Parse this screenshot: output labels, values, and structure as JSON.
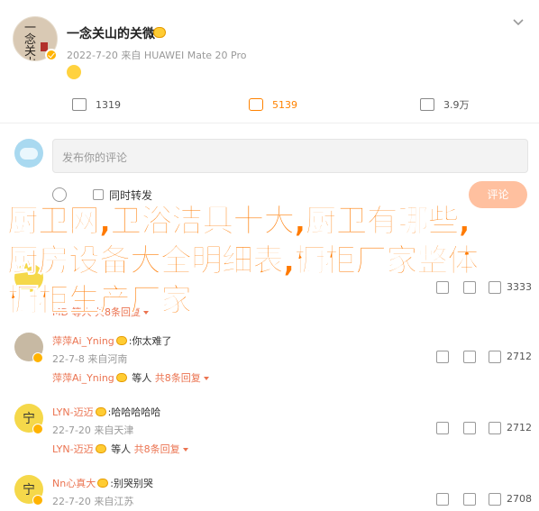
{
  "post": {
    "author": "一念关山的关微",
    "meta": "2022-7-20  来自 HUAWEI Mate 20 Pro",
    "author_avatar_text": "一念关山",
    "avatar_icon": "calligraphy-avatar",
    "verified_icon": "verified-badge-icon",
    "more_icon": "chevron-down-icon"
  },
  "stats": {
    "repost": "1319",
    "comment": "5139",
    "like": "3.9万",
    "colors": {
      "comment_accent": "#ff8200"
    }
  },
  "composer": {
    "placeholder": "发布你的评论",
    "forward_label": "同时转发",
    "reply_button": "评论",
    "reply_button_color": "#ffc09f"
  },
  "comments": [
    {
      "user": "",
      "text": "",
      "avatar_glyph": "",
      "time": "",
      "reply_user": "",
      "reply_text": "",
      "reply_count": "",
      "likes": "3333"
    },
    {
      "user": "萍萍Ai_Yning",
      "text": ":你太难了",
      "avatar_glyph": "",
      "time": "22-7-8 来自河南",
      "reply_user": "萍萍Ai_Yning",
      "reply_text": "等人",
      "reply_count": "共8条回复",
      "likes": "2712"
    },
    {
      "user": "LYN-迈迈",
      "text": ":哈哈哈哈哈",
      "avatar_glyph": "宁",
      "time": "22-7-20 来自天津",
      "reply_user": "LYN-迈迈",
      "reply_text": "等人",
      "reply_count": "共8条回复",
      "likes": "2712"
    },
    {
      "user": "Nn心真大",
      "text": ":别哭别哭",
      "avatar_glyph": "宁",
      "time": "22-7-20 来自江苏",
      "reply_user": "",
      "reply_text": "",
      "reply_count": "",
      "likes": "2708"
    }
  ],
  "first_comment_extra": {
    "reply_prefix": "MD 等人",
    "reply_count": "共8条回复",
    "label": "回复"
  },
  "overlay": {
    "headline": "厨卫网,卫浴洁具十大,厨卫有哪些,厨房设备大全明细表,橱柜厂家整体橱柜生产厂家",
    "color": "#ff7a00"
  },
  "comment_repost_icon": "repost-icon",
  "comment_reply_icon": "comment-icon",
  "comment_like_icon": "like-icon"
}
